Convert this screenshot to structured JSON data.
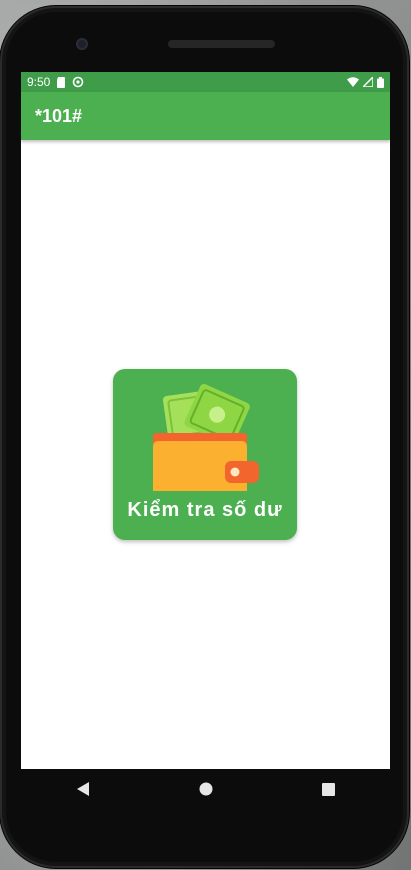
{
  "status_bar": {
    "time": "9:50",
    "icons": [
      "sim-card-icon",
      "sync-icon",
      "wifi-icon",
      "signal-icon",
      "battery-icon"
    ]
  },
  "app_bar": {
    "title": "*101#",
    "color": "#4caf50"
  },
  "main": {
    "balance_button": {
      "label": "Kiểm tra số dư",
      "icon": "wallet-icon",
      "color": "#4caf50"
    }
  },
  "nav_bar": {
    "buttons": [
      "back-icon",
      "home-icon",
      "recents-icon"
    ]
  }
}
